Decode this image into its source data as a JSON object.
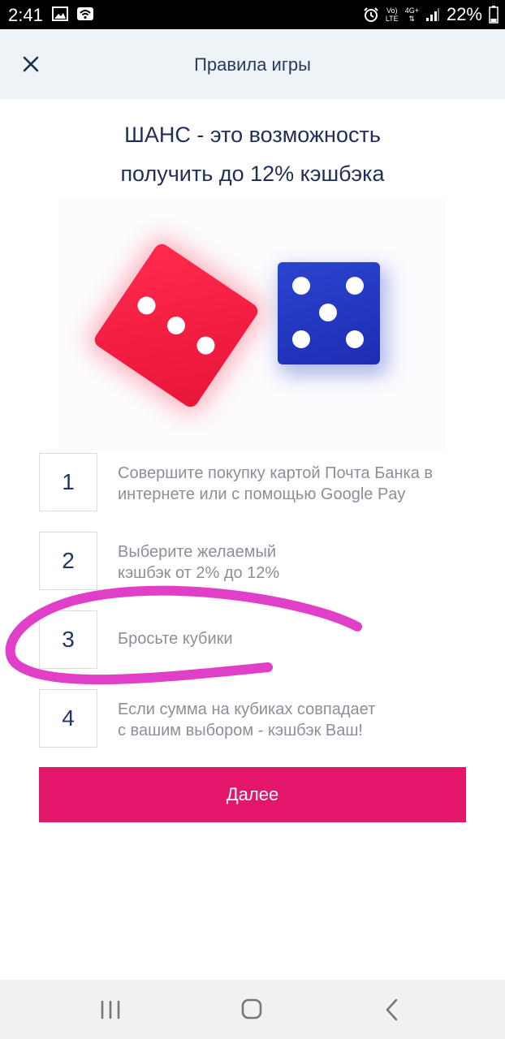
{
  "status_bar": {
    "time": "2:41",
    "network_top": "Vo)",
    "network_bottom": "LTE",
    "net_type": "4G+",
    "battery": "22%",
    "icons": [
      "image-icon",
      "wifi-icon",
      "alarm-icon",
      "signal-icon",
      "battery-icon"
    ]
  },
  "header": {
    "title": "Правила игры",
    "close_icon": "close-icon"
  },
  "headline": {
    "line1": "ШАНС - это возможность",
    "line2": "получить до 12% кэшбэка"
  },
  "dice": {
    "red_die_pips": 3,
    "blue_die_pips": 5,
    "red_color": "#f01f44",
    "blue_color": "#2336c2"
  },
  "steps": [
    {
      "number": "1",
      "line1": "Совершите покупку картой Почта Банка в",
      "line2": "интернете или с помощью Google Pay"
    },
    {
      "number": "2",
      "line1": "Выберите желаемый",
      "line2": "кэшбэк от 2% до 12%"
    },
    {
      "number": "3",
      "line1": "Бросьте кубики",
      "line2": ""
    },
    {
      "number": "4",
      "line1": "Если сумма на кубиках совпадает",
      "line2": "с вашим выбором - кэшбэк Ваш!"
    }
  ],
  "next_button": {
    "label": "Далее",
    "color": "#e3166b"
  },
  "annotation": {
    "color": "#e040c8"
  },
  "nav_bar": {
    "icons": [
      "recent-apps-icon",
      "home-icon",
      "back-icon"
    ]
  }
}
